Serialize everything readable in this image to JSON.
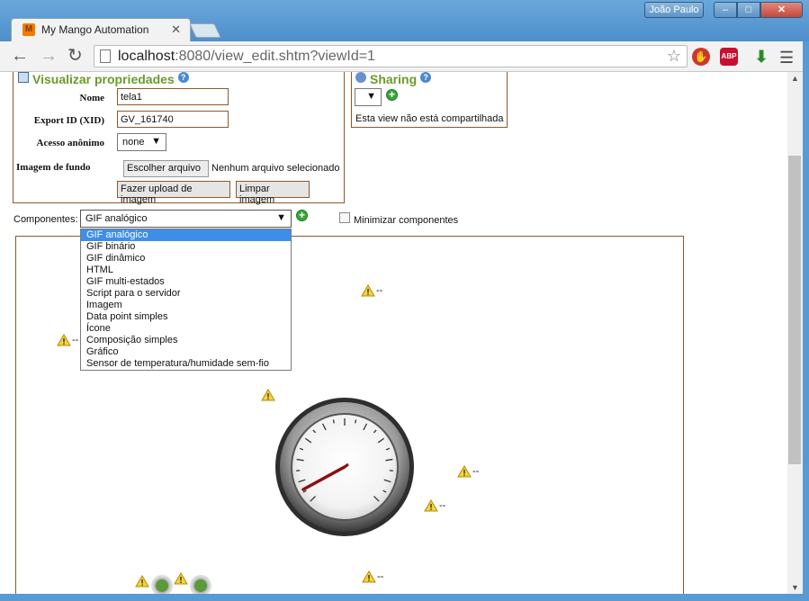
{
  "browser": {
    "tab_title": "My Mango Automation",
    "tab_favicon": "M",
    "user_label": "João Paulo",
    "url_host": "localhost",
    "url_rest": ":8080/view_edit.shtm?viewId=1",
    "ext_abp": "ABP"
  },
  "properties": {
    "title": "Visualizar propriedades",
    "name_label": "Nome",
    "name_value": "tela1",
    "xid_label": "Export ID (XID)",
    "xid_value": "GV_161740",
    "anon_label": "Acesso anônimo",
    "anon_value": "none",
    "bg_label": "Imagem de fundo",
    "choose_file": "Escolher arquivo",
    "no_file": "Nenhum arquivo selecionado",
    "upload": "Fazer upload de imagem",
    "clear": "Limpar imagem"
  },
  "sharing": {
    "title": "Sharing",
    "status": "Esta view não está compartilhada"
  },
  "components": {
    "label": "Componentes:",
    "selected": "GIF analógico",
    "minimize_label": "Minimizar componentes",
    "options": [
      "GIF analógico",
      "GIF binário",
      "GIF dinâmico",
      "HTML",
      "GIF multi-estados",
      "Script para o servidor",
      "Imagem",
      "Data point simples",
      "Ícone",
      "Composição simples",
      "Gráfico",
      "Sensor de temperatura/humidade sem-fio"
    ]
  },
  "canvas": {
    "warning_suffix": "--"
  },
  "colors": {
    "accent_green": "#6a9a2a",
    "border_brown": "#8b5a2b",
    "selection_blue": "#3d8ee9"
  }
}
